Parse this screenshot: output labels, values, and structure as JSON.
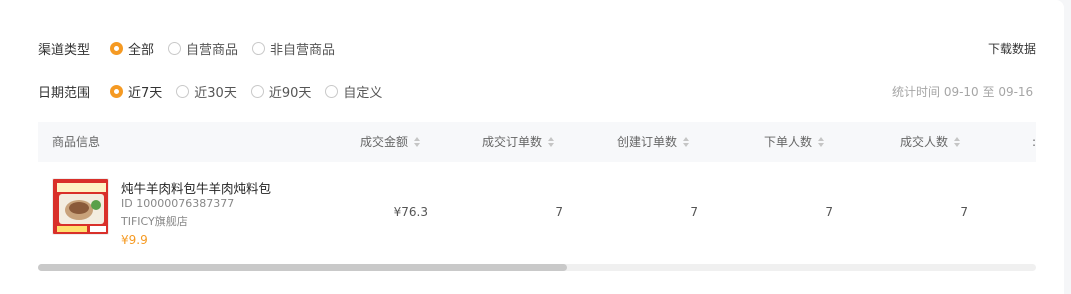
{
  "filters": {
    "channel": {
      "label": "渠道类型",
      "options": [
        {
          "label": "全部",
          "checked": true
        },
        {
          "label": "自营商品",
          "checked": false
        },
        {
          "label": "非自营商品",
          "checked": false
        }
      ]
    },
    "date": {
      "label": "日期范围",
      "options": [
        {
          "label": "近7天",
          "checked": true
        },
        {
          "label": "近30天",
          "checked": false
        },
        {
          "label": "近90天",
          "checked": false
        },
        {
          "label": "自定义",
          "checked": false
        }
      ]
    }
  },
  "download_label": "下载数据",
  "stat_time": "统计时间 09-10 至 09-16",
  "table": {
    "headers": [
      "商品信息",
      "成交金额",
      "成交订单数",
      "创建订单数",
      "下单人数",
      "成交人数"
    ],
    "rows": [
      {
        "name": "炖牛羊肉料包牛羊肉炖料包",
        "id": "ID 10000076387377",
        "shop": "TIFICY旗舰店",
        "price": "¥9.9",
        "amount": "¥76.3",
        "deal_orders": "7",
        "created_orders": "7",
        "buyers": "7",
        "deal_buyers": "7"
      }
    ]
  },
  "scrollbar": {
    "visible_fraction": 0.53
  },
  "colors": {
    "accent": "#f59a23",
    "header_bg": "#f7f8fa"
  }
}
